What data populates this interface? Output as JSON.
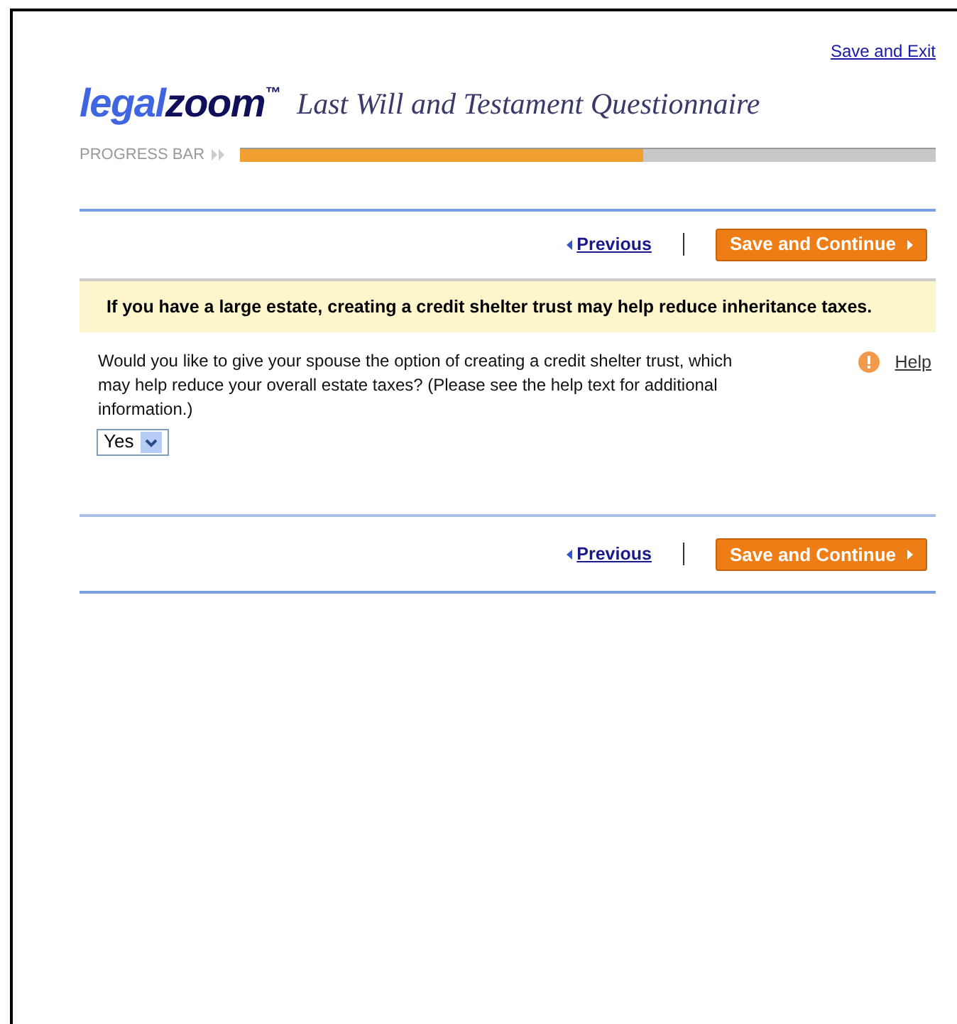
{
  "header": {
    "save_exit_link": "Save and Exit",
    "logo": {
      "part_1": "legal",
      "part_2": "zoom",
      "mark": "™"
    },
    "title": "Last Will and Testament Questionnaire"
  },
  "progress": {
    "label": "PROGRESS BAR",
    "level": 0.58
  },
  "nav_top": {
    "previous": "Previous",
    "continue": "Save and Continue"
  },
  "notice": "If you have a large estate, creating a credit shelter trust may help reduce inheritance taxes.",
  "question": {
    "text": "Would you like to give your spouse the option of creating a credit shelter trust, which may help reduce your overall estate taxes? (Please see the help text for additional information.)",
    "help": "Help",
    "answer": "Yes"
  },
  "nav_bottom": {
    "previous": "Previous",
    "continue": "Save and Continue"
  }
}
